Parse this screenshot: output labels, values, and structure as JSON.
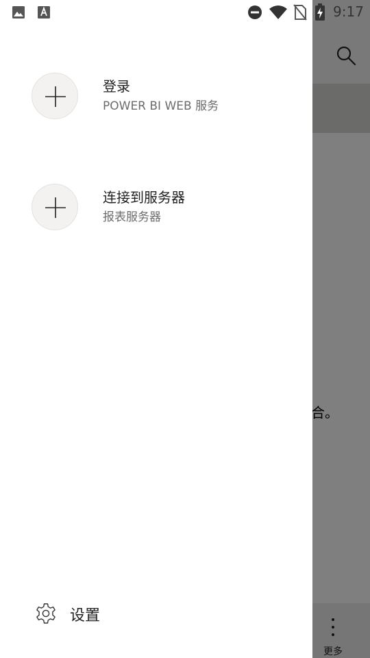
{
  "status_bar": {
    "time": "9:17",
    "left_icons": [
      "image-icon",
      "font-app-icon"
    ],
    "right_icons": [
      "do-not-disturb-icon",
      "wifi-icon",
      "no-sim-icon",
      "battery-charging-icon"
    ]
  },
  "drawer": {
    "items": [
      {
        "title": "登录",
        "subtitle": "POWER BI WEB 服务",
        "icon": "plus-icon"
      },
      {
        "title": "连接到服务器",
        "subtitle": "报表服务器",
        "icon": "plus-icon"
      }
    ],
    "settings": {
      "label": "设置",
      "icon": "gear-icon"
    }
  },
  "background": {
    "partial_text": "合。",
    "more_label": "更多",
    "icons": [
      "search-icon",
      "more-vertical-icon"
    ]
  },
  "colors": {
    "drawer_bg": "#ffffff",
    "scrim": "rgba(0,0,0,0.5)",
    "circle_bg": "#f3f2f1",
    "text_primary": "#1f1f1f",
    "text_secondary": "#6b6b6b"
  }
}
